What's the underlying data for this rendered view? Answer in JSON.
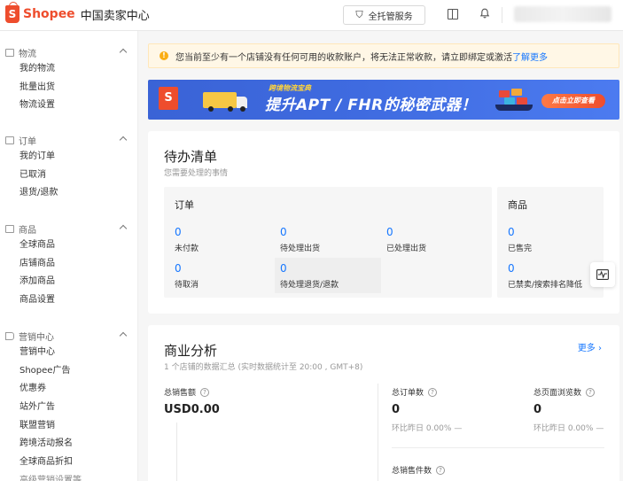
{
  "header": {
    "brand": "Shopee",
    "subtitle": "中国卖家中心",
    "service_label": "全托管服务"
  },
  "sidebar": {
    "sections": [
      {
        "title": "物流",
        "items": [
          "我的物流",
          "批量出货",
          "物流设置"
        ]
      },
      {
        "title": "订单",
        "items": [
          "我的订单",
          "已取消",
          "退货/退款"
        ]
      },
      {
        "title": "商品",
        "items": [
          "全球商品",
          "店铺商品",
          "添加商品",
          "商品设置"
        ]
      },
      {
        "title": "营销中心",
        "items": [
          "营销中心",
          "Shopee广告",
          "优惠券",
          "站外广告",
          "联盟营销",
          "跨境活动报名",
          "全球商品折扣",
          "高级营销设置等"
        ]
      }
    ]
  },
  "alert": {
    "text": "您当前至少有一个店铺没有任何可用的收款账户，将无法正常收款，请立即绑定或激活",
    "link": "了解更多"
  },
  "banner": {
    "small_text": "跨境物流宝典",
    "title": "提升APT / FHR的秘密武器！",
    "cta": "点击立即查看"
  },
  "todo": {
    "title": "待办清单",
    "subtitle": "您需要处理的事情",
    "orders": {
      "title": "订单",
      "metrics": [
        {
          "value": "0",
          "label": "未付款"
        },
        {
          "value": "0",
          "label": "待处理出货"
        },
        {
          "value": "0",
          "label": "已处理出货"
        },
        {
          "value": "0",
          "label": "待取消"
        },
        {
          "value": "0",
          "label": "待处理退货/退款"
        }
      ]
    },
    "products": {
      "title": "商品",
      "metrics": [
        {
          "value": "0",
          "label": "已售完"
        },
        {
          "value": "0",
          "label": "已禁卖/搜索排名降低"
        }
      ]
    }
  },
  "business": {
    "title": "商业分析",
    "subtitle": "1 个店铺的数据汇总 (实时数据统计至 20:00 , GMT+8)",
    "more": "更多",
    "stats": [
      {
        "label": "总销售额",
        "value": "USD0.00",
        "compare": ""
      },
      {
        "label": "总订单数",
        "value": "0",
        "compare": "环比昨日 0.00%  —"
      },
      {
        "label": "总页面浏览数",
        "value": "0",
        "compare": "环比昨日 0.00%  —"
      }
    ],
    "units_label": "总销售件数"
  }
}
